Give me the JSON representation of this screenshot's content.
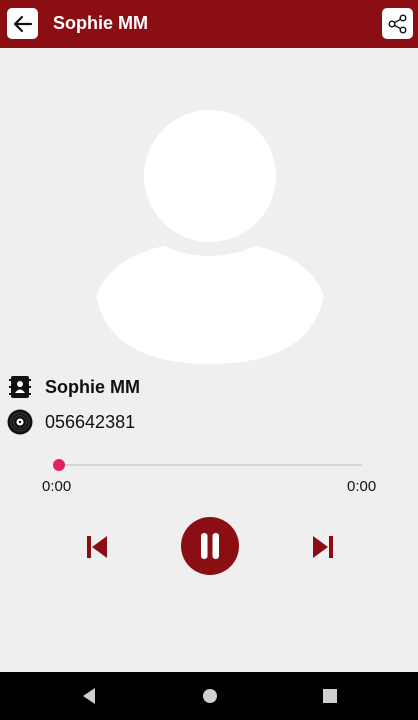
{
  "header": {
    "title": "Sophie MM",
    "back_icon": "arrow-left-icon",
    "share_icon": "share-icon"
  },
  "contact": {
    "avatar_icon": "person-placeholder-icon",
    "name": "Sophie MM",
    "name_icon": "contact-book-icon",
    "number": "056642381",
    "number_icon": "vinyl-record-icon"
  },
  "player": {
    "progress": 0,
    "elapsed": "0:00",
    "duration": "0:00",
    "state": "playing",
    "prev_icon": "skip-previous-icon",
    "pause_icon": "pause-icon",
    "next_icon": "skip-next-icon"
  },
  "system_nav": {
    "back_icon": "nav-back-triangle-icon",
    "home_icon": "nav-home-circle-icon",
    "recents_icon": "nav-recents-square-icon"
  },
  "colors": {
    "primary": "#8b0f12",
    "accent": "#e0245e",
    "background": "#efefef"
  }
}
